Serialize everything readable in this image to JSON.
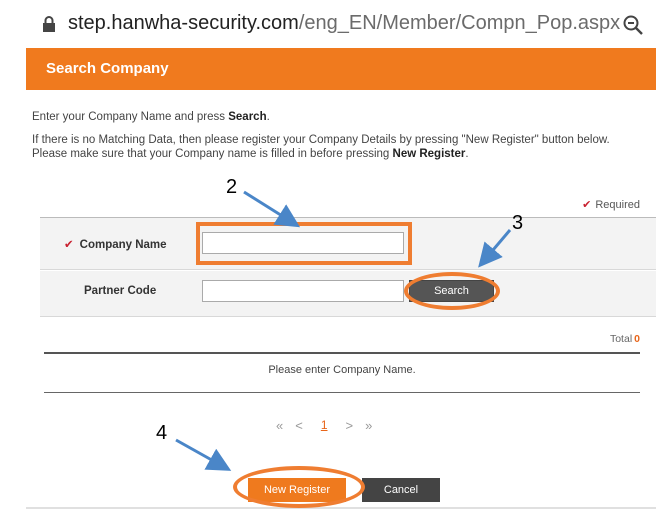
{
  "browser": {
    "url_domain": "step.hanwha-security.com",
    "url_path": "/eng_EN/Member/Compn_Pop.aspx"
  },
  "header": {
    "title": "Search Company"
  },
  "intro": {
    "line1_prefix": "Enter your Company Name and press ",
    "line1_bold": "Search",
    "line1_suffix": ".",
    "line2_prefix": "If there is no Matching Data, then please register your Company Details by pressing \"New Register\" button below. Please make sure that your Company name is filled in before pressing ",
    "line2_bold": "New Register",
    "line2_suffix": "."
  },
  "required_label": "Required",
  "form": {
    "company_name_label": "Company Name",
    "company_name_value": "",
    "partner_code_label": "Partner Code",
    "partner_code_value": "",
    "search_button": "Search"
  },
  "results": {
    "total_label": "Total",
    "total_count": "0",
    "empty_message": "Please enter Company Name."
  },
  "pager": {
    "first": "«",
    "prev": "<",
    "current": "1",
    "next": ">",
    "last": "»"
  },
  "actions": {
    "new_register": "New Register",
    "cancel": "Cancel"
  },
  "annotations": {
    "step2": "2",
    "step3": "3",
    "step4": "4"
  },
  "colors": {
    "accent": "#f07a1e",
    "highlight": "#ef7d31",
    "arrow": "#4a86c8",
    "required": "#c8202f"
  }
}
